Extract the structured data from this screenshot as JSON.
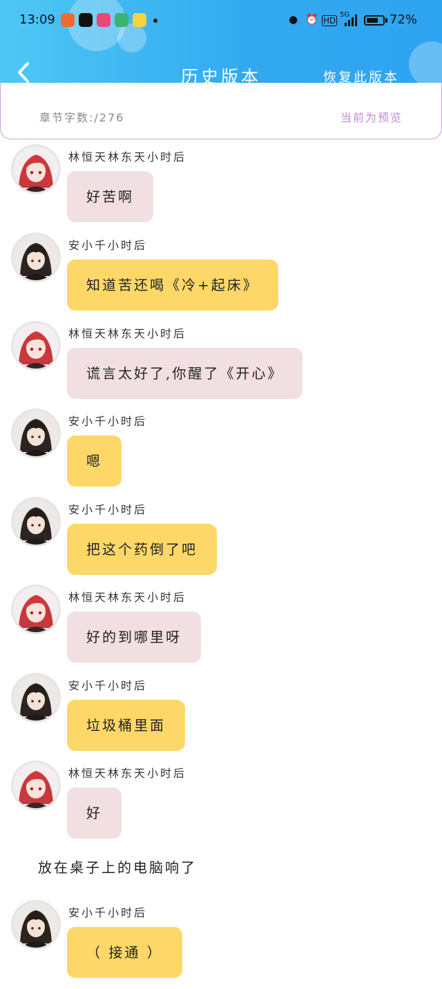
{
  "status_bar": {
    "time": "13:09",
    "network": "5G",
    "hd_label": "HD",
    "battery_percent": "72%",
    "battery_level": 0.72
  },
  "header": {
    "title": "历史版本",
    "restore_label": "恢复此版本",
    "background_color": "#33aaf0"
  },
  "info": {
    "word_count": "章节字数:/276",
    "preview_label": "当前为预览"
  },
  "characters": {
    "a": {
      "name": "林恒天林东天小时后",
      "avatar_icon": "red-hair-avatar"
    },
    "b": {
      "name": "安小千小时后",
      "avatar_icon": "dark-hair-avatar"
    }
  },
  "messages": [
    {
      "speaker": "林恒天林东天小时后",
      "text": "好苦啊",
      "color": "#f1dfe2"
    },
    {
      "speaker": "安小千小时后",
      "text": "知道苦还喝《冷+起床》",
      "color": "#fdd869"
    },
    {
      "speaker": "林恒天林东天小时后",
      "text": "谎言太好了,你醒了《开心》",
      "color": "#f1dfe2"
    },
    {
      "speaker": "安小千小时后",
      "text": "嗯",
      "color": "#fdd869"
    },
    {
      "speaker": "安小千小时后",
      "text": "把这个药倒了吧",
      "color": "#fdd869"
    },
    {
      "speaker": "林恒天林东天小时后",
      "text": "好的到哪里呀",
      "color": "#f1dfe2"
    },
    {
      "speaker": "安小千小时后",
      "text": "垃圾桶里面",
      "color": "#fdd869"
    },
    {
      "speaker": "林恒天林东天小时后",
      "text": "好",
      "color": "#f1dfe2"
    },
    {
      "narration": "放在桌子上的电脑响了"
    },
    {
      "speaker": "安小千小时后",
      "text": "（ 接通 ）",
      "color": "#fdd869"
    }
  ]
}
